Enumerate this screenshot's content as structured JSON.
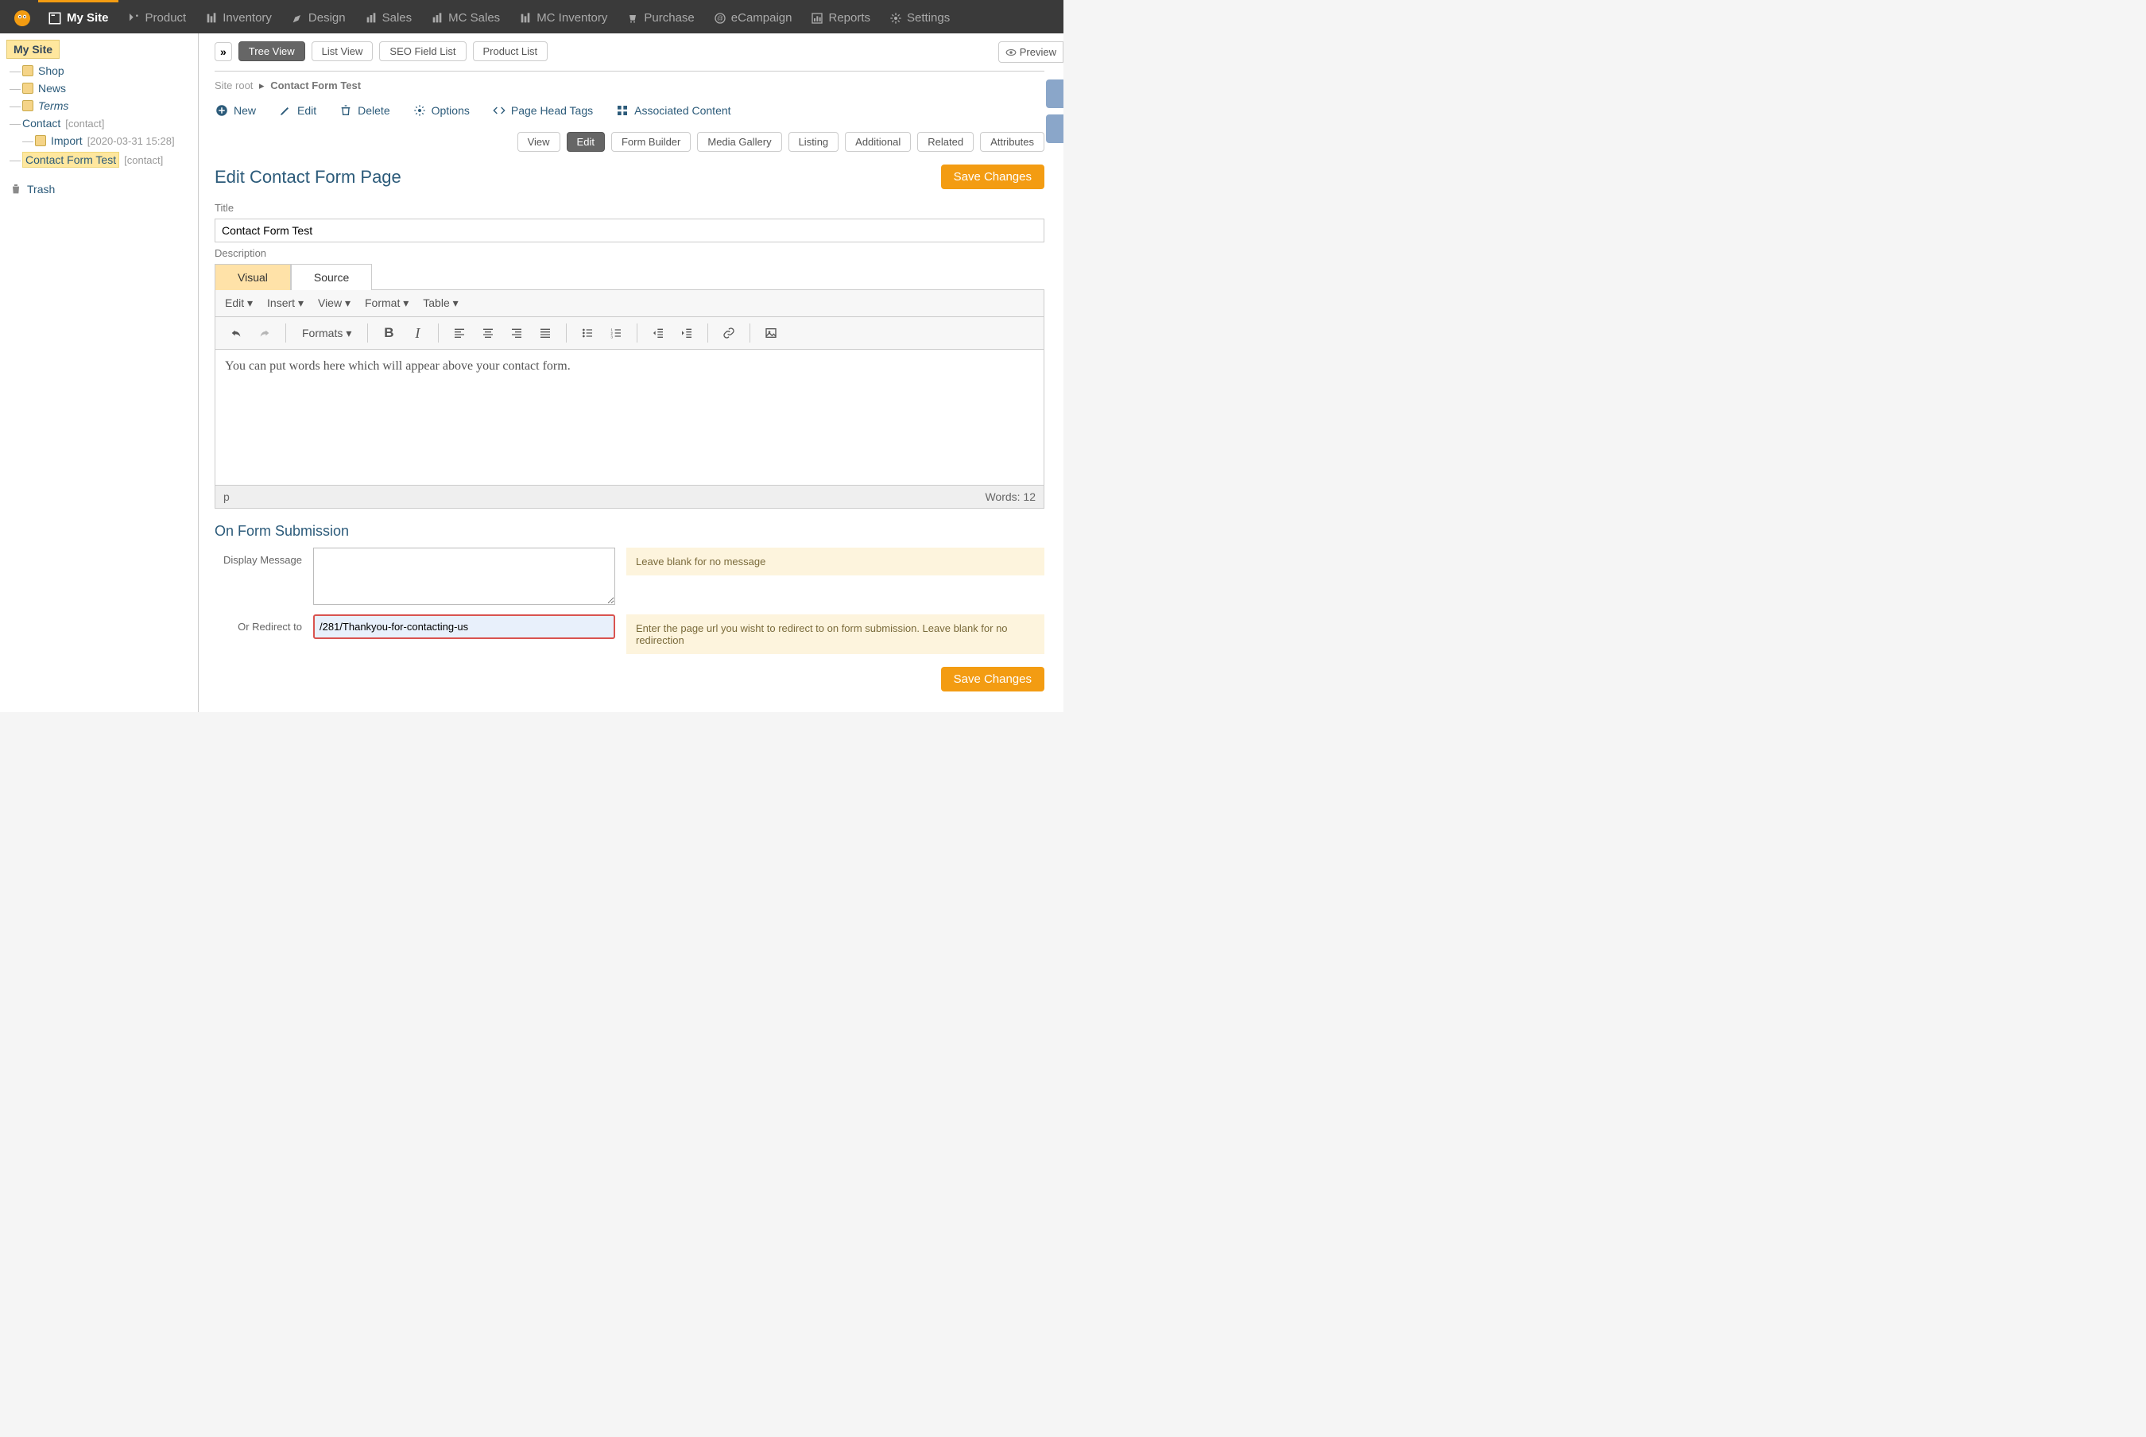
{
  "topnav": {
    "items": [
      {
        "label": "My Site"
      },
      {
        "label": "Product"
      },
      {
        "label": "Inventory"
      },
      {
        "label": "Design"
      },
      {
        "label": "Sales"
      },
      {
        "label": "MC Sales"
      },
      {
        "label": "MC Inventory"
      },
      {
        "label": "Purchase"
      },
      {
        "label": "eCampaign"
      },
      {
        "label": "Reports"
      },
      {
        "label": "Settings"
      }
    ]
  },
  "sidebar": {
    "root": "My Site",
    "nodes": [
      {
        "label": "Shop",
        "folder": true
      },
      {
        "label": "News",
        "folder": true
      },
      {
        "label": "Terms",
        "folder": true,
        "italic": true
      },
      {
        "label": "Contact",
        "suffix": "[contact]",
        "folder": false
      },
      {
        "label": "Import",
        "suffix": "[2020-03-31 15:28]",
        "folder": true,
        "indent": true
      },
      {
        "label": "Contact Form Test",
        "suffix": "[contact]",
        "folder": false,
        "selected": true
      }
    ],
    "trash": "Trash"
  },
  "viewbar": {
    "tree": "Tree View",
    "list": "List View",
    "seo": "SEO Field List",
    "product": "Product List",
    "preview": "Preview"
  },
  "breadcrumb": {
    "root": "Site root",
    "leaf": "Contact Form Test"
  },
  "actions": {
    "new": "New",
    "edit": "Edit",
    "delete": "Delete",
    "options": "Options",
    "head": "Page Head Tags",
    "assoc": "Associated Content"
  },
  "tabs": {
    "view": "View",
    "edit": "Edit",
    "formbuilder": "Form Builder",
    "media": "Media Gallery",
    "listing": "Listing",
    "additional": "Additional",
    "related": "Related",
    "attributes": "Attributes"
  },
  "page": {
    "heading": "Edit Contact Form Page",
    "save": "Save Changes",
    "title_label": "Title",
    "title_value": "Contact Form Test",
    "desc_label": "Description"
  },
  "editor": {
    "tab_visual": "Visual",
    "tab_source": "Source",
    "menu": {
      "edit": "Edit",
      "insert": "Insert",
      "view": "View",
      "format": "Format",
      "table": "Table"
    },
    "formats": "Formats",
    "content": "You can put words here which will appear above your contact form.",
    "path": "p",
    "words": "Words: 12"
  },
  "formsub": {
    "heading": "On Form Submission",
    "display_msg_label": "Display Message",
    "display_msg_hint": "Leave blank for no message",
    "redirect_label": "Or Redirect to",
    "redirect_value": "/281/Thankyou-for-contacting-us",
    "redirect_hint": "Enter the page url you wisht to redirect to on form submission. Leave blank for no redirection"
  }
}
